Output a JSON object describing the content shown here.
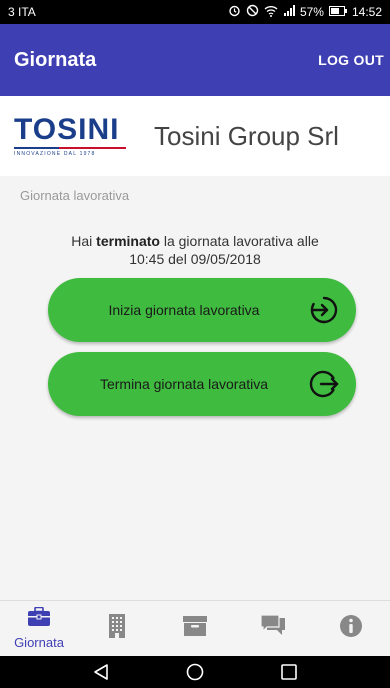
{
  "status_bar": {
    "carrier": "3 ITA",
    "battery": "57%",
    "time": "14:52"
  },
  "app_bar": {
    "title": "Giornata",
    "logout_label": "LOG OUT",
    "color": "#3f3fb4"
  },
  "company": {
    "logo_text": "TOSINI",
    "logo_tagline": "INNOVAZIONE DAL 1978",
    "name": "Tosini Group Srl"
  },
  "section_label": "Giornata lavorativa",
  "status_message": {
    "prefix": "Hai ",
    "bold": "terminato",
    "suffix": " la giornata lavorativa alle",
    "line2": "10:45 del 09/05/2018"
  },
  "buttons": {
    "start_label": "Inizia giornata lavorativa",
    "end_label": "Termina giornata lavorativa",
    "color": "#3fbb3f"
  },
  "tabs": [
    {
      "label": "Giornata",
      "icon": "briefcase-icon",
      "active": true
    },
    {
      "label": "",
      "icon": "building-icon",
      "active": false
    },
    {
      "label": "",
      "icon": "archive-icon",
      "active": false
    },
    {
      "label": "",
      "icon": "chat-icon",
      "active": false
    },
    {
      "label": "",
      "icon": "info-icon",
      "active": false
    }
  ]
}
